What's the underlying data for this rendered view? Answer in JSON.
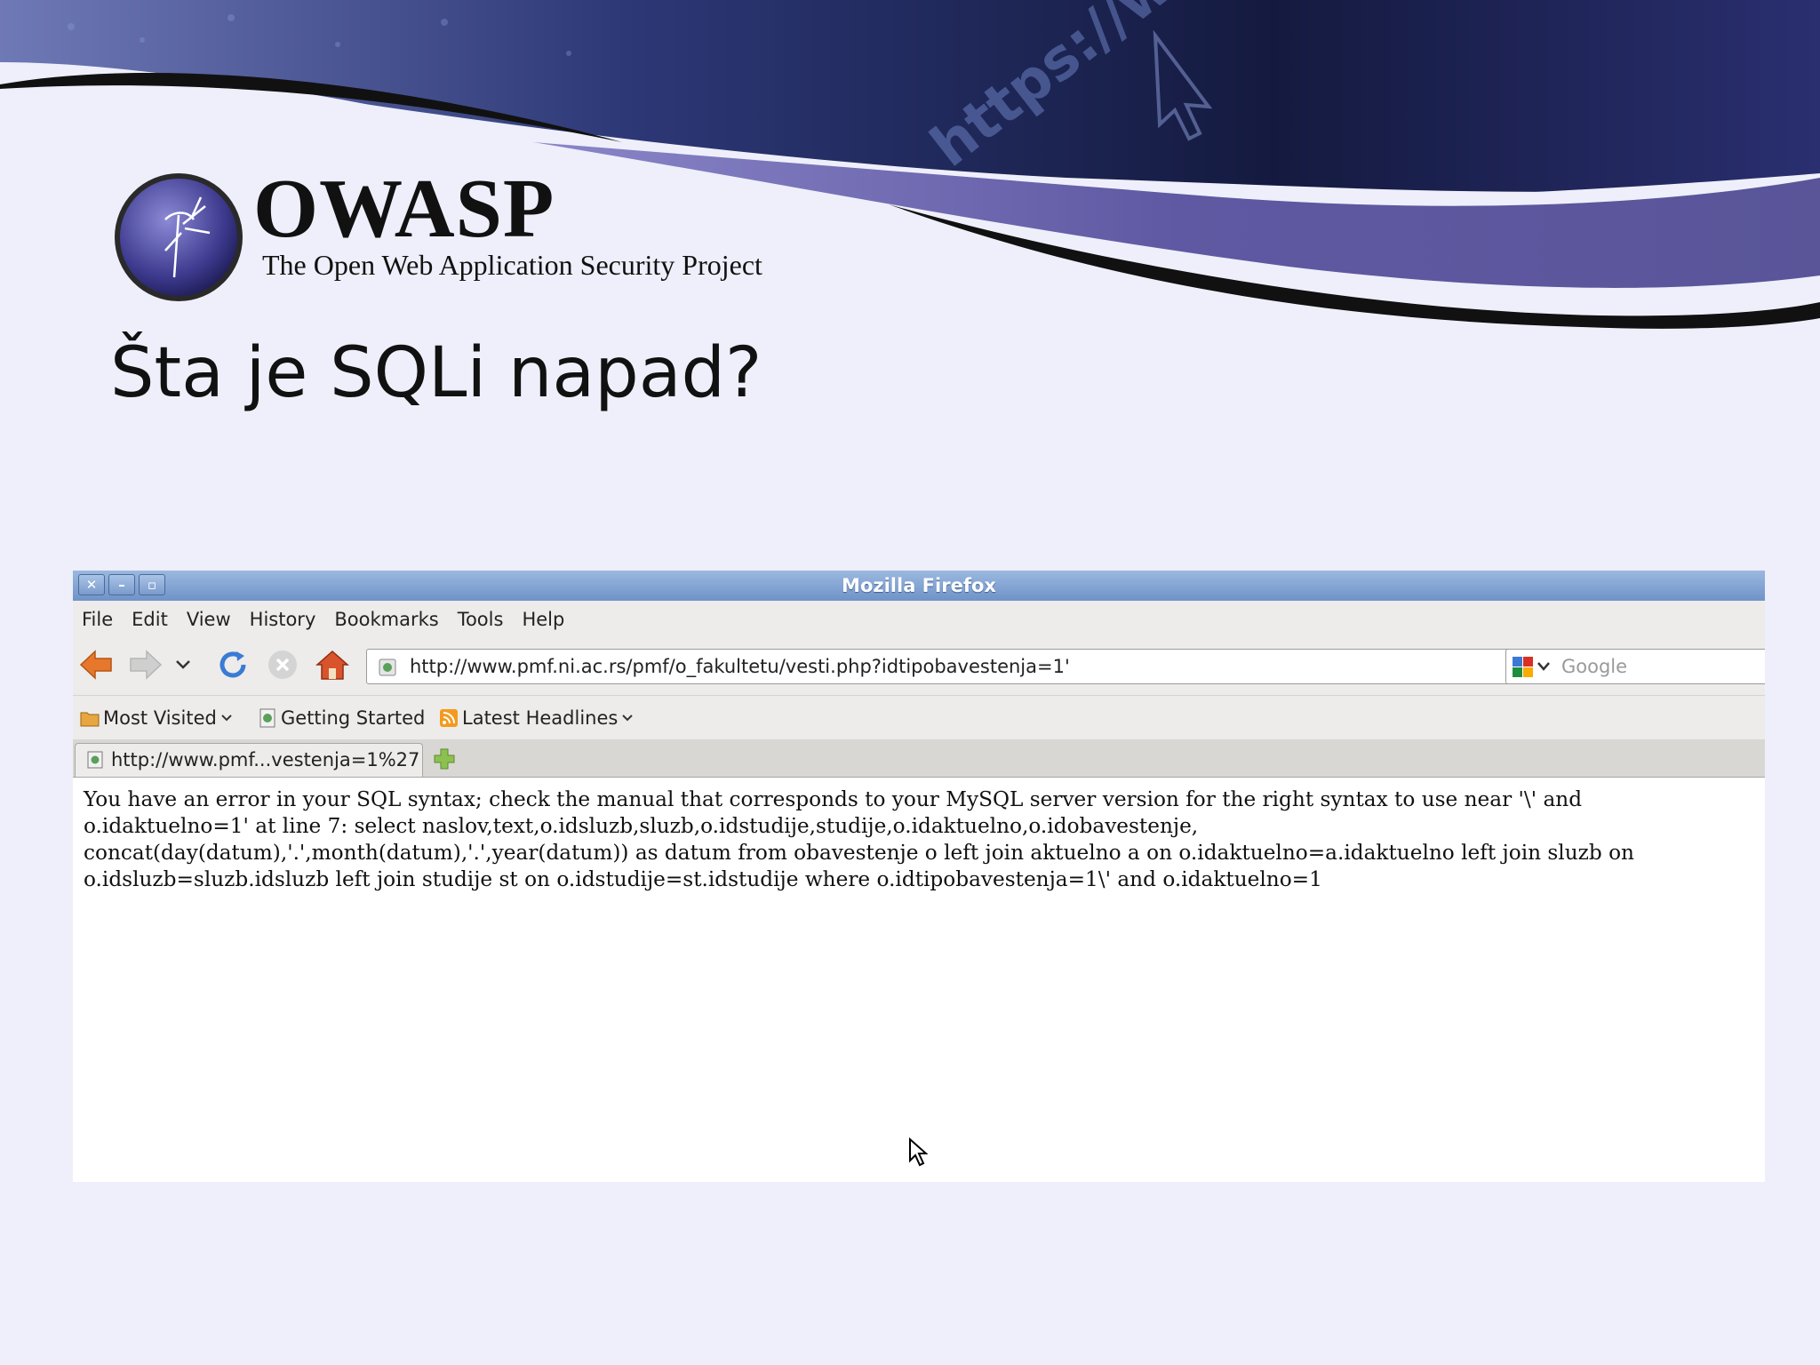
{
  "slide": {
    "logo_title": "OWASP",
    "logo_subtitle": "The Open Web Application Security Project",
    "banner_watermark": "https://www",
    "heading": "Šta je SQLi napad?"
  },
  "browser": {
    "window_title": "Mozilla Firefox",
    "window_buttons": [
      "close-icon",
      "minimize-icon",
      "maximize-icon"
    ],
    "menu": [
      "File",
      "Edit",
      "View",
      "History",
      "Bookmarks",
      "Tools",
      "Help"
    ],
    "url": "http://www.pmf.ni.ac.rs/pmf/o_fakultetu/vesti.php?idtipobavestenja=1'",
    "search_placeholder": "Google",
    "bookmarks": {
      "most_visited": "Most Visited",
      "getting_started": "Getting Started",
      "latest_headlines": "Latest Headlines"
    },
    "tab_label": "http://www.pmf...vestenja=1%27",
    "error_lines": [
      "You have an error in your SQL syntax; check the manual that corresponds to your MySQL server version for the right syntax to use near '\\' and",
      "o.idaktuelno=1' at line 7: select naslov,text,o.idsluzb,sluzb,o.idstudije,studije,o.idaktuelno,o.idobavestenje,",
      "concat(day(datum),'.',month(datum),'.',year(datum)) as datum from obavestenje o left join aktuelno a on o.idaktuelno=a.idaktuelno left join sluzb on",
      "o.idsluzb=sluzb.idsluzb left join studije st on o.idstudije=st.idstudije where o.idtipobavestenja=1\\' and o.idaktuelno=1"
    ]
  },
  "colors": {
    "slide_background": "#eeeffa",
    "banner_purple": "#5d58a0",
    "banner_navy": "#1c2148",
    "titlebar_blue": "#7a9bcc"
  }
}
